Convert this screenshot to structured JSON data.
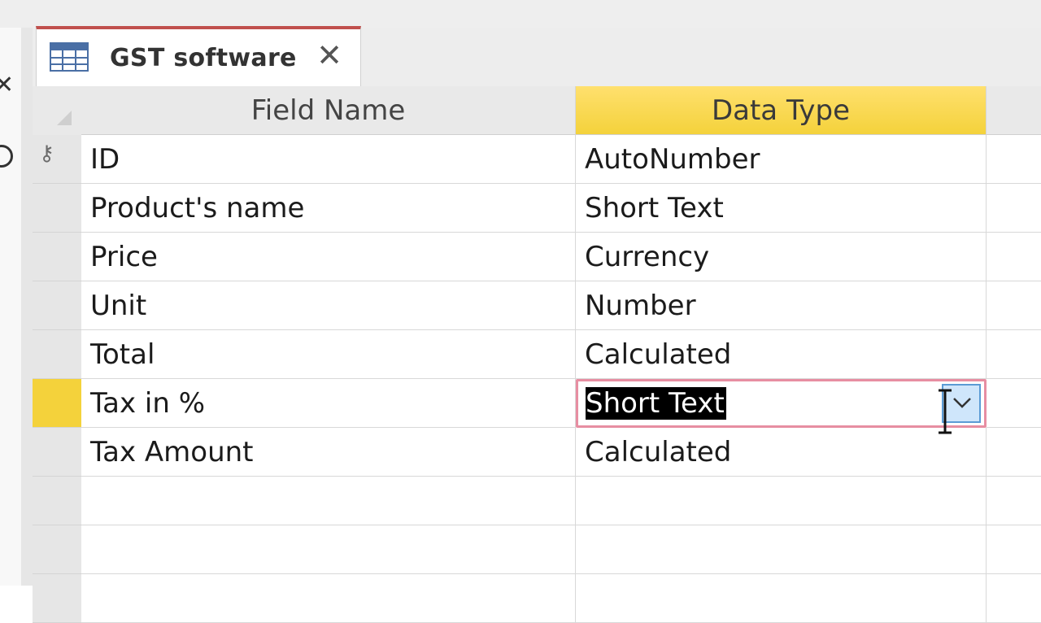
{
  "tab": {
    "title": "GST software",
    "close_glyph": "✕"
  },
  "columns": {
    "field_name": "Field Name",
    "data_type": "Data Type"
  },
  "rows": [
    {
      "field": "ID",
      "type": "AutoNumber",
      "primary_key": true
    },
    {
      "field": "Product's name",
      "type": "Short Text"
    },
    {
      "field": "Price",
      "type": "Currency"
    },
    {
      "field": "Unit",
      "type": "Number"
    },
    {
      "field": "Total",
      "type": "Calculated"
    },
    {
      "field": "Tax in %",
      "type": "Short Text",
      "active": true
    },
    {
      "field": "Tax Amount",
      "type": "Calculated"
    },
    {
      "field": "",
      "type": ""
    },
    {
      "field": "",
      "type": ""
    },
    {
      "field": "",
      "type": ""
    }
  ],
  "icons": {
    "tab": "table-icon",
    "close": "close-icon",
    "key": "primary-key-icon",
    "dropdown": "chevron-down-icon",
    "cursor": "text-cursor-icon"
  },
  "colors": {
    "accent_tab": "#c0504d",
    "selected_header": "#f4d23b",
    "active_cell_border": "#e78ea2",
    "dropdown_border": "#5b9bd5"
  }
}
